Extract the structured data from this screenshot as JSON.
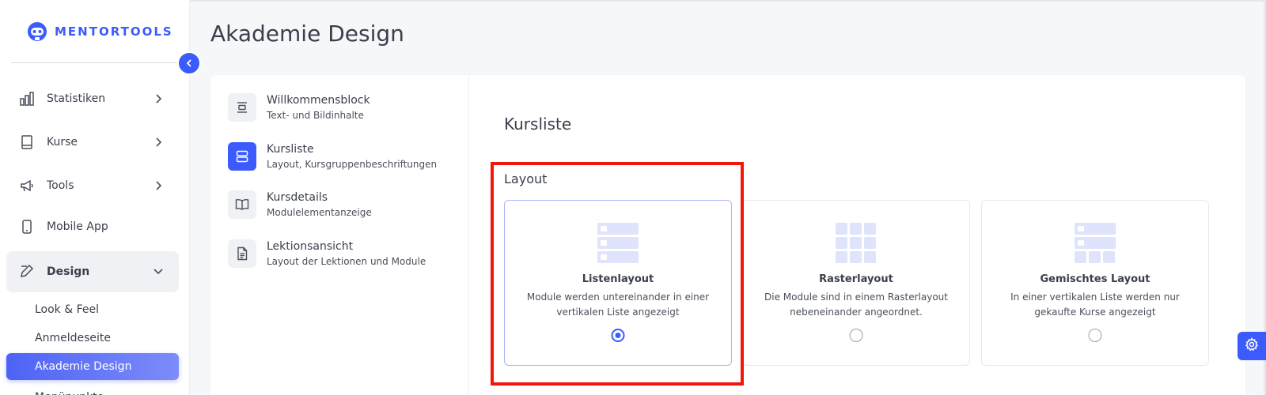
{
  "brand": {
    "name": "MENTORTOOLS",
    "accent": "#3b5bfd"
  },
  "sidebar": {
    "items": [
      {
        "label": "Statistiken",
        "icon": "bar-chart-icon",
        "expandable": true
      },
      {
        "label": "Kurse",
        "icon": "book-icon",
        "expandable": true
      },
      {
        "label": "Tools",
        "icon": "megaphone-icon",
        "expandable": true
      },
      {
        "label": "Mobile App",
        "icon": "phone-icon",
        "expandable": false
      },
      {
        "label": "Design",
        "icon": "pencil-icon",
        "expandable": true,
        "expanded": true
      }
    ],
    "design_subitems": [
      {
        "label": "Look & Feel"
      },
      {
        "label": "Anmeldeseite"
      },
      {
        "label": "Akademie Design",
        "active": true
      },
      {
        "label": "Menüpunkte"
      }
    ]
  },
  "page": {
    "title": "Akademie Design"
  },
  "sections": [
    {
      "title": "Willkommensblock",
      "subtitle": "Text- und Bildinhalte",
      "icon": "align-center-icon"
    },
    {
      "title": "Kursliste",
      "subtitle": "Layout, Kursgruppenbeschriftungen",
      "icon": "list-layout-icon",
      "active": true
    },
    {
      "title": "Kursdetails",
      "subtitle": "Modulelementanzeige",
      "icon": "open-book-icon"
    },
    {
      "title": "Lektionsansicht",
      "subtitle": "Layout der Lektionen und Module",
      "icon": "document-icon"
    }
  ],
  "content": {
    "title": "Kursliste",
    "layout_label": "Layout",
    "options": [
      {
        "title": "Listenlayout",
        "description": "Module werden untereinander in einer vertikalen Liste angezeigt",
        "selected": true,
        "icon": "list-layout-illustration"
      },
      {
        "title": "Rasterlayout",
        "description": "Die Module sind in einem Rasterlayout nebeneinander angeordnet.",
        "selected": false,
        "icon": "grid-layout-illustration"
      },
      {
        "title": "Gemischtes Layout",
        "description": "In einer vertikalen Liste werden nur gekaufte Kurse angezeigt",
        "selected": false,
        "icon": "mixed-layout-illustration"
      }
    ]
  },
  "colors": {
    "highlight": "#f2170b",
    "illustration": "#dfe3fb"
  }
}
